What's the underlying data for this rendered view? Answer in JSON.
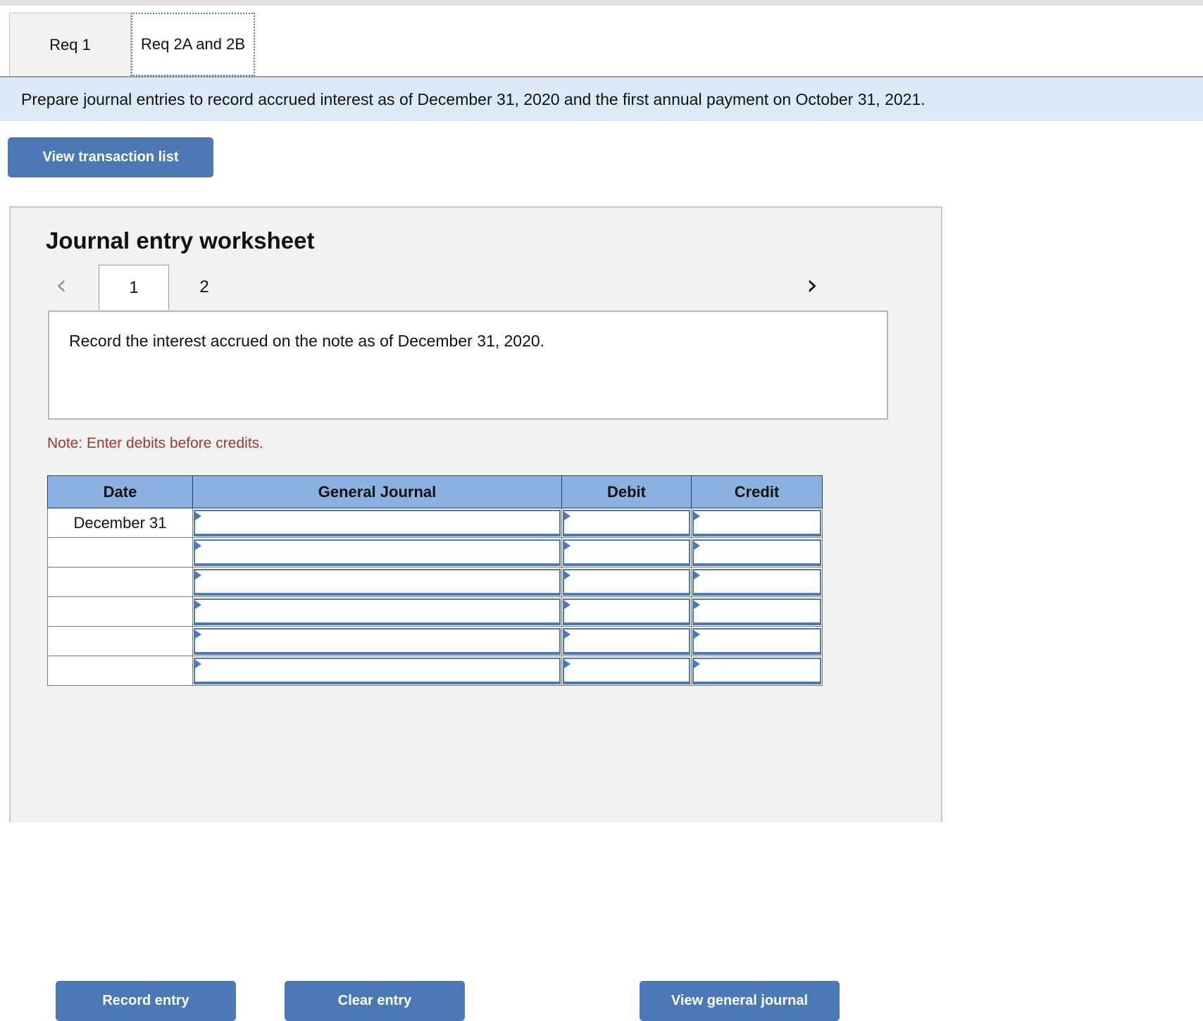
{
  "tabs": [
    {
      "label": "Req 1",
      "active": false
    },
    {
      "label": "Req 2A and 2B",
      "active": true
    }
  ],
  "banner": {
    "text": "Prepare journal entries to record accrued interest as of December 31, 2020 and the first annual payment on October 31, 2021."
  },
  "toolbar": {
    "view_transaction_list_label": "View transaction list"
  },
  "worksheet": {
    "title": "Journal entry worksheet",
    "pager": {
      "prev_icon": "‹",
      "next_icon": "›",
      "pages": [
        "1",
        "2"
      ],
      "current_page": "1"
    },
    "description": "Record the interest accrued on the note as of December 31, 2020.",
    "note": "Note: Enter debits before credits."
  },
  "journal_table": {
    "columns": [
      "Date",
      "General Journal",
      "Debit",
      "Credit"
    ],
    "rows": [
      {
        "date": "December 31",
        "general_journal": "",
        "debit": "",
        "credit": ""
      },
      {
        "date": "",
        "general_journal": "",
        "debit": "",
        "credit": ""
      },
      {
        "date": "",
        "general_journal": "",
        "debit": "",
        "credit": ""
      },
      {
        "date": "",
        "general_journal": "",
        "debit": "",
        "credit": ""
      },
      {
        "date": "",
        "general_journal": "",
        "debit": "",
        "credit": ""
      },
      {
        "date": "",
        "general_journal": "",
        "debit": "",
        "credit": ""
      }
    ]
  },
  "actions": {
    "record_entry_label": "Record entry",
    "clear_entry_label": "Clear entry",
    "view_general_journal_label": "View general journal"
  },
  "colors": {
    "accent_blue": "#4a79b5",
    "header_blue": "#8cb0e0",
    "banner_blue": "#dce9f7",
    "panel_gray": "#f2f2f2",
    "note_red": "#a5352e"
  }
}
